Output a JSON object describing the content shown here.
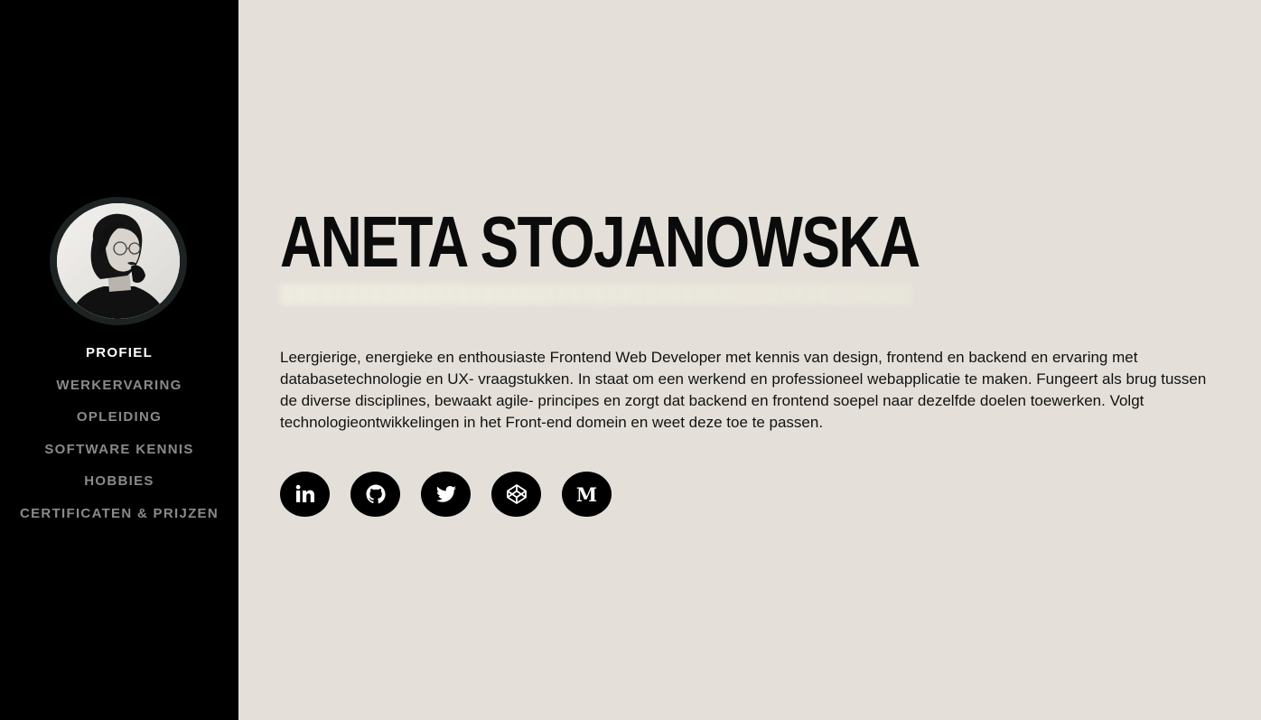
{
  "profile": {
    "name": "ANETA STOJANOWSKA",
    "bio": "Leergierige, energieke en enthousiaste Frontend Web Developer met kennis van design, frontend en backend en ervaring met databasetechnologie en UX- vraagstukken. In staat om een werkend en professioneel webapplicatie te maken. Fungeert als brug tussen de diverse disciplines, bewaakt agile- principes en zorgt dat backend en frontend soepel naar dezelfde doelen toewerken. Volgt technologieontwikkelingen in het Front-end domein en weet deze toe te passen."
  },
  "nav": {
    "items": [
      {
        "label": "PROFIEL",
        "active": true
      },
      {
        "label": "WERKERVARING",
        "active": false
      },
      {
        "label": "OPLEIDING",
        "active": false
      },
      {
        "label": "SOFTWARE KENNIS",
        "active": false
      },
      {
        "label": "HOBBIES",
        "active": false
      },
      {
        "label": "CERTIFICATEN & PRIJZEN",
        "active": false
      }
    ]
  },
  "socials": [
    {
      "icon": "linkedin-icon",
      "glyph": "in"
    },
    {
      "icon": "github-icon"
    },
    {
      "icon": "twitter-icon"
    },
    {
      "icon": "codepen-icon"
    },
    {
      "icon": "medium-icon",
      "glyph": "M"
    }
  ],
  "colors": {
    "sidebar": "#000000",
    "background": "#e4e0d9",
    "nav_active": "#ffffff",
    "nav_inactive": "#8a8a8a",
    "text": "#111111"
  }
}
